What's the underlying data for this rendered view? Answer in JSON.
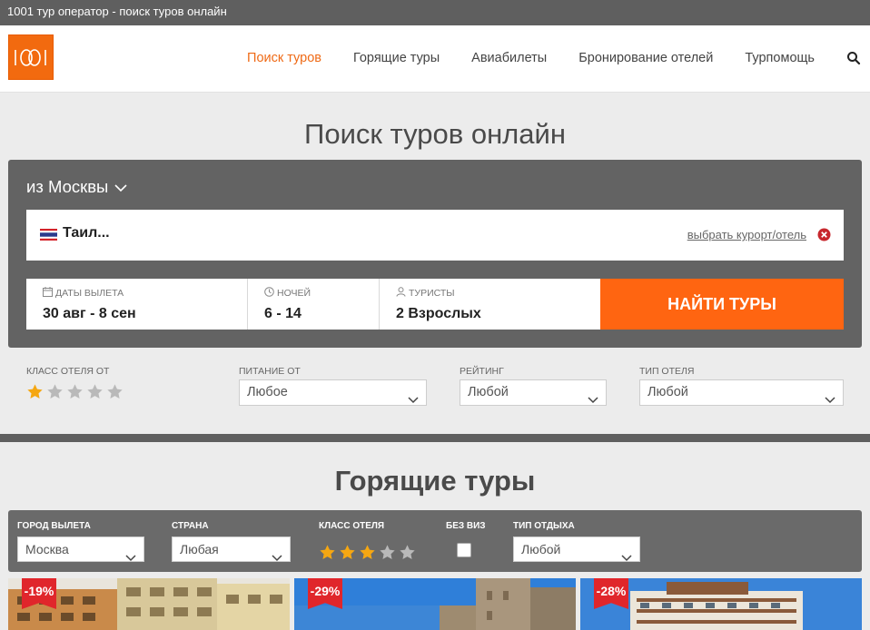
{
  "window": {
    "title": "1001 тур оператор - поиск туров онлайн"
  },
  "brand": {
    "logo_text": "1001",
    "accent": "#ef6a16"
  },
  "nav": {
    "items": [
      {
        "label": "Поиск туров",
        "active": true
      },
      {
        "label": "Горящие туры",
        "active": false
      },
      {
        "label": "Авиабилеты",
        "active": false
      },
      {
        "label": "Бронирование отелей",
        "active": false
      },
      {
        "label": "Турпомощь",
        "active": false
      }
    ],
    "search_icon": "search-icon"
  },
  "search": {
    "title": "Поиск туров онлайн",
    "from": "из Москвы",
    "destination": "Таил...",
    "destination_flag": "thailand-flag",
    "choose_link": "выбрать курорт/отель",
    "dates_label": "Даты вылета",
    "dates_value": "30 авг - 8 сен",
    "nights_label": "Ночей",
    "nights_value": "6 - 14",
    "tourists_label": "Туристы",
    "tourists_value": "2 Взрослых",
    "find_button": "НАЙТИ ТУРЫ",
    "button_color": "#ff6511"
  },
  "filters": {
    "hotel_class_label": "Класс отеля от",
    "hotel_class_value": 1,
    "hotel_class_max": 5,
    "meal_label": "Питание от",
    "meal_value": "Любое",
    "rating_label": "Рейтинг",
    "rating_value": "Любой",
    "hotel_type_label": "Тип отеля",
    "hotel_type_value": "Любой"
  },
  "hot": {
    "title": "Горящие туры",
    "city_label": "Город вылета",
    "city_value": "Москва",
    "country_label": "Страна",
    "country_value": "Любая",
    "class_label": "Класс отеля",
    "class_value": 3,
    "novisa_label": "Без виз",
    "rest_type_label": "Тип отдыха",
    "rest_type_value": "Любой"
  },
  "cards": [
    {
      "discount": "-19%"
    },
    {
      "discount": "-29%"
    },
    {
      "discount": "-28%"
    }
  ]
}
